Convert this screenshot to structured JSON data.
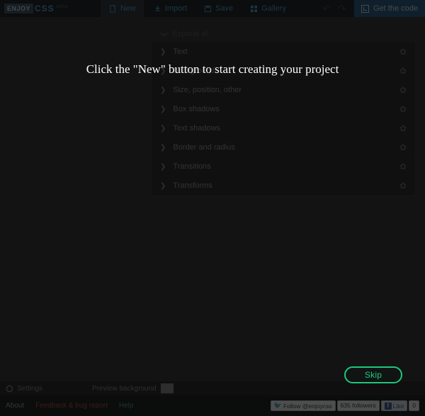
{
  "logo": {
    "enjoy": "ENJOY",
    "css": "CSS",
    "alpha": "alpha"
  },
  "nav": {
    "new": "New",
    "import": "Import",
    "save": "Save",
    "gallery": "Gallery"
  },
  "getcode": "Get the code",
  "panels": {
    "expand_all": "Expand all",
    "items": [
      {
        "label": "Text"
      },
      {
        "label": "Background"
      },
      {
        "label": "Size, position, other"
      },
      {
        "label": "Box shadows"
      },
      {
        "label": "Text shadows"
      },
      {
        "label": "Border and radius"
      },
      {
        "label": "Transitions"
      },
      {
        "label": "Transforms"
      }
    ]
  },
  "bottom": {
    "settings": "Settings",
    "preview_bg": "Preview background"
  },
  "footer": {
    "about": "About",
    "feedback": "Feedback & bug report",
    "help": "Help",
    "twitter_follow": "Follow @enjoycss",
    "twitter_followers": "635 followers",
    "fb_like": "Like",
    "fb_count": "0"
  },
  "overlay": {
    "message": "Click the \"New\" button to start creating your project",
    "skip": "Skip"
  }
}
